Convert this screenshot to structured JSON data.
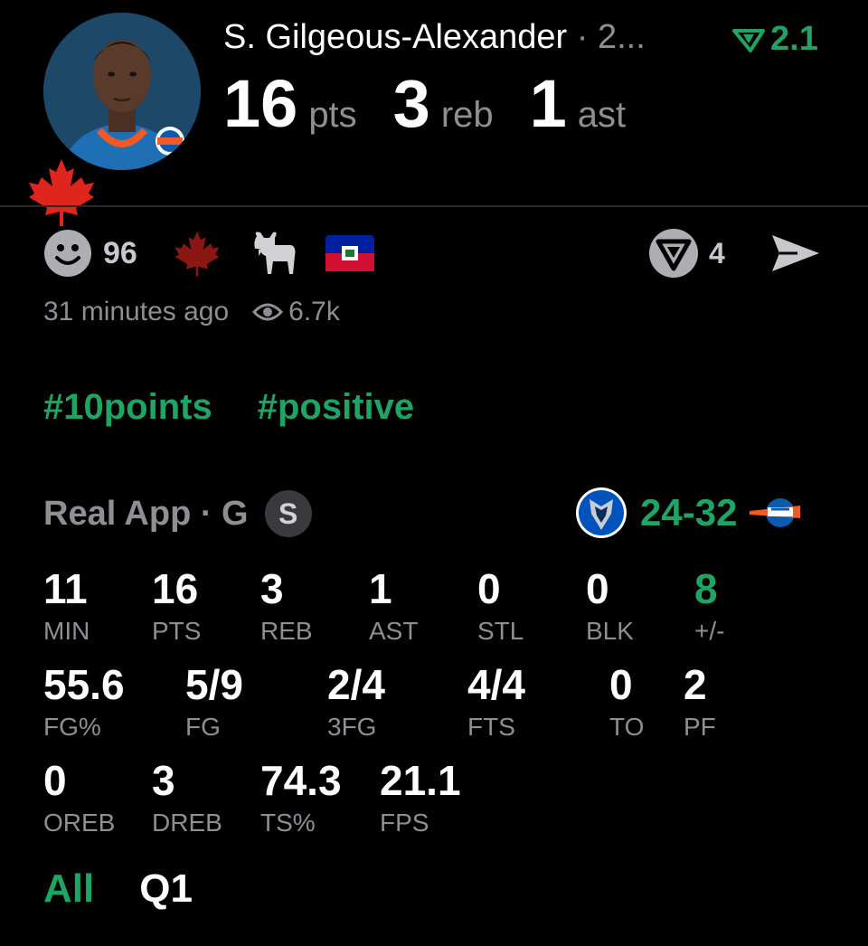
{
  "header": {
    "player_name": "S. Gilgeous-Alexander",
    "date_truncated": " · 2...",
    "vig_value": "2.1",
    "pts": "16",
    "pts_unit": "pts",
    "reb": "3",
    "reb_unit": "reb",
    "ast": "1",
    "ast_unit": "ast"
  },
  "reactions": {
    "smile_count": "96",
    "icons": [
      "smile-icon",
      "maple-leaf-icon",
      "goat-icon",
      "haiti-flag-icon"
    ],
    "vote_count": "4"
  },
  "meta": {
    "time_ago": "31 minutes ago",
    "views": "6.7k"
  },
  "hashtags": [
    "#10points",
    "#positive"
  ],
  "game": {
    "source": "Real App · G",
    "position_badge": "S",
    "away_score": "24",
    "separator": "-",
    "home_score": "32"
  },
  "stats": {
    "row1": [
      {
        "value": "11",
        "label": "MIN"
      },
      {
        "value": "16",
        "label": "PTS"
      },
      {
        "value": "3",
        "label": "REB"
      },
      {
        "value": "1",
        "label": "AST"
      },
      {
        "value": "0",
        "label": "STL"
      },
      {
        "value": "0",
        "label": "BLK"
      },
      {
        "value": "8",
        "label": "+/-"
      }
    ],
    "row2": [
      {
        "value": "55.6",
        "label": "FG%"
      },
      {
        "value": "5/9",
        "label": "FG"
      },
      {
        "value": "2/4",
        "label": "3FG"
      },
      {
        "value": "4/4",
        "label": "FTS"
      },
      {
        "value": "0",
        "label": "TO"
      },
      {
        "value": "2",
        "label": "PF"
      }
    ],
    "row3": [
      {
        "value": "0",
        "label": "OREB"
      },
      {
        "value": "3",
        "label": "DREB"
      },
      {
        "value": "74.3",
        "label": "TS%"
      },
      {
        "value": "21.1",
        "label": "FPS"
      }
    ]
  },
  "tabs": [
    "All",
    "Q1"
  ],
  "colors": {
    "accent": "#1fa463",
    "muted": "#8e8e93",
    "background": "#000000"
  }
}
